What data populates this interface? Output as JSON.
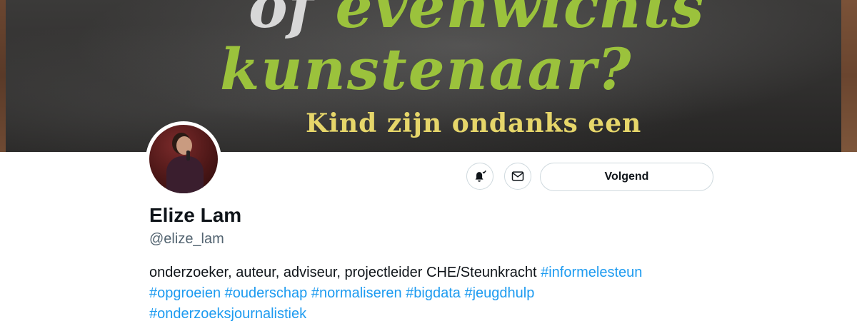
{
  "banner": {
    "word_of": "of",
    "word_evenwichts": "evenwichts",
    "line2": "kunstenaar?",
    "line3": "Kind zijn ondanks een"
  },
  "profile": {
    "name": "Elize Lam",
    "handle": "@elize_lam",
    "bio_text": "onderzoeker, auteur, adviseur, projectleider CHE/Steunkracht",
    "hashtags": [
      "#informelesteun",
      "#opgroeien",
      "#ouderschap",
      "#normaliseren",
      "#bigdata",
      "#jeugdhulp",
      "#onderzoeksjournalistiek"
    ]
  },
  "actions": {
    "notify_icon": "bell-check-icon",
    "message_icon": "envelope-icon",
    "follow_label": "Volgend"
  },
  "colors": {
    "link": "#1d9bf0",
    "text": "#0f1419",
    "muted": "#536471",
    "border": "#cfd9de"
  }
}
